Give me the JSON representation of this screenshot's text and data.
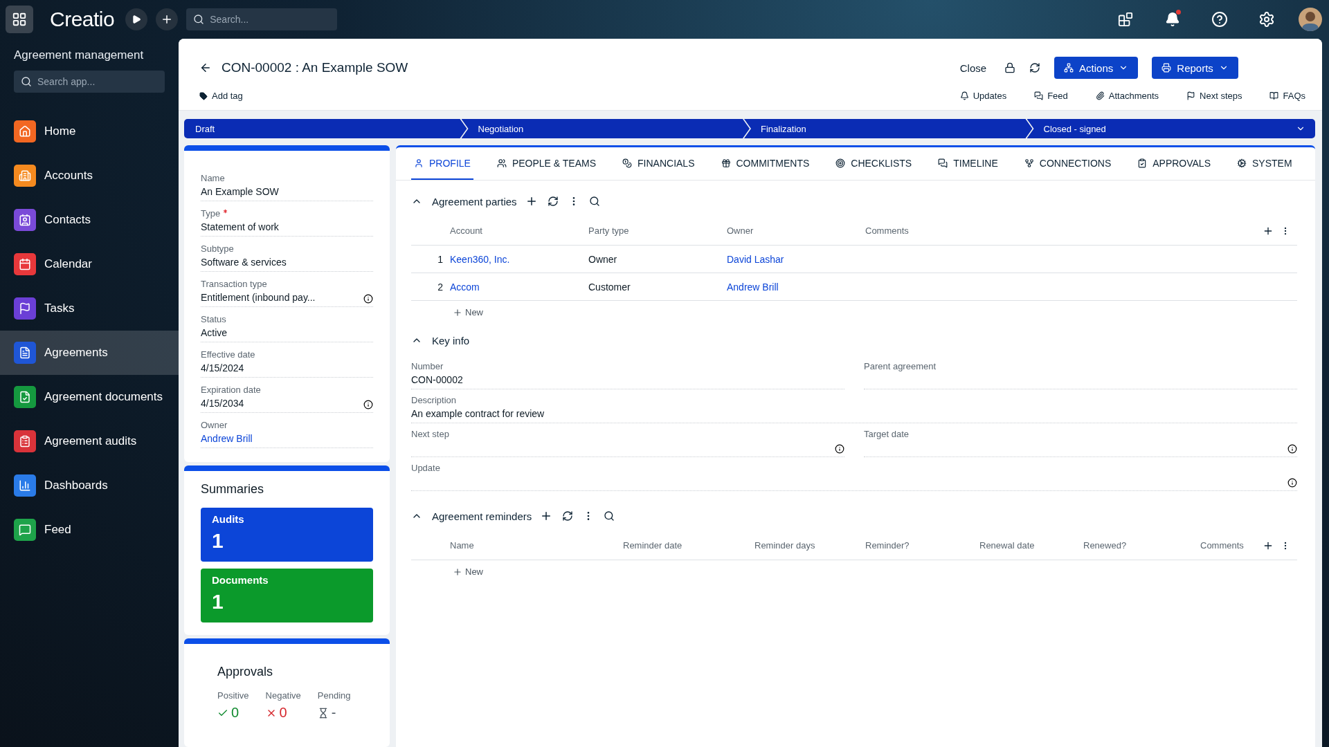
{
  "top_bar": {
    "logo": "Creatio",
    "search": {
      "placeholder": "Search..."
    },
    "has_notifications": true
  },
  "sidebar": {
    "title": "Agreement management",
    "search": {
      "placeholder": "Search app..."
    },
    "items": [
      {
        "label": "Home",
        "color": "#f26722",
        "selected": false
      },
      {
        "label": "Accounts",
        "color": "#f58a1f",
        "selected": false
      },
      {
        "label": "Contacts",
        "color": "#7a4ad8",
        "selected": false
      },
      {
        "label": "Calendar",
        "color": "#e8383b",
        "selected": false
      },
      {
        "label": "Tasks",
        "color": "#6b3fd6",
        "selected": false
      },
      {
        "label": "Agreements",
        "color": "#1f56d6",
        "selected": true
      },
      {
        "label": "Agreement documents",
        "color": "#15993f",
        "selected": false
      },
      {
        "label": "Agreement audits",
        "color": "#d9333a",
        "selected": false
      },
      {
        "label": "Dashboards",
        "color": "#2a7be8",
        "selected": false
      },
      {
        "label": "Feed",
        "color": "#1ea34a",
        "selected": false
      }
    ]
  },
  "record": {
    "title": "CON-00002 : An Example SOW",
    "add_tag": "Add tag",
    "close": "Close",
    "actions": "Actions",
    "reports": "Reports",
    "links": [
      "Updates",
      "Feed",
      "Attachments",
      "Next steps",
      "FAQs"
    ]
  },
  "stages": [
    {
      "label": "Draft"
    },
    {
      "label": "Negotiation"
    },
    {
      "label": "Finalization"
    },
    {
      "label": "Closed - signed"
    }
  ],
  "profile": [
    {
      "label": "Name",
      "value": "An Example SOW",
      "kind": "text",
      "required": false,
      "info": false
    },
    {
      "label": "Type",
      "value": "Statement of work",
      "kind": "text",
      "required": true,
      "info": false
    },
    {
      "label": "Subtype",
      "value": "Software & services",
      "kind": "text",
      "required": false,
      "info": false
    },
    {
      "label": "Transaction type",
      "value": "Entitlement (inbound pay...",
      "kind": "text",
      "required": false,
      "info": true
    },
    {
      "label": "Status",
      "value": "Active",
      "kind": "text",
      "required": false,
      "info": false
    },
    {
      "label": "Effective date",
      "value": "4/15/2024",
      "kind": "text",
      "required": false,
      "info": false
    },
    {
      "label": "Expiration date",
      "value": "4/15/2034",
      "kind": "text",
      "required": false,
      "info": true
    },
    {
      "label": "Owner",
      "value": "Andrew Brill",
      "kind": "link",
      "required": false,
      "info": false
    }
  ],
  "summaries": {
    "title": "Summaries",
    "cards": [
      {
        "label": "Audits",
        "value": "1",
        "color": "#0c45d8"
      },
      {
        "label": "Documents",
        "value": "1",
        "color": "#0b9a2b"
      }
    ]
  },
  "approvals": {
    "title": "Approvals",
    "stats": [
      {
        "label": "Positive",
        "value": "0",
        "kind": "positive"
      },
      {
        "label": "Negative",
        "value": "0",
        "kind": "negative"
      },
      {
        "label": "Pending",
        "value": "-",
        "kind": "pending"
      }
    ]
  },
  "tabs": [
    {
      "label": "PROFILE",
      "selected": true
    },
    {
      "label": "PEOPLE & TEAMS",
      "selected": false
    },
    {
      "label": "FINANCIALS",
      "selected": false
    },
    {
      "label": "COMMITMENTS",
      "selected": false
    },
    {
      "label": "CHECKLISTS",
      "selected": false
    },
    {
      "label": "TIMELINE",
      "selected": false
    },
    {
      "label": "CONNECTIONS",
      "selected": false
    },
    {
      "label": "APPROVALS",
      "selected": false
    },
    {
      "label": "SYSTEM",
      "selected": false
    }
  ],
  "parties": {
    "title": "Agreement parties",
    "columns": [
      "Account",
      "Party type",
      "Owner",
      "Comments"
    ],
    "rows": [
      {
        "index": "1",
        "account": "Keen360, Inc.",
        "party_type": "Owner",
        "owner": "David Lashar"
      },
      {
        "index": "2",
        "account": "Accom",
        "party_type": "Customer",
        "owner": "Andrew Brill"
      }
    ],
    "new_label": "New"
  },
  "key_info": {
    "title": "Key info",
    "fields": [
      {
        "label": "Number",
        "value": "CON-00002",
        "kind": "half",
        "info": false
      },
      {
        "label": "Parent agreement",
        "kind": "half",
        "info": false
      },
      {
        "label": "Description",
        "value": "An example contract for review",
        "kind": "wide",
        "info": false
      },
      {
        "label": "Next step",
        "kind": "half",
        "info": true
      },
      {
        "label": "Target date",
        "kind": "half",
        "info": true
      },
      {
        "label": "Update",
        "kind": "wide",
        "info": true
      }
    ]
  },
  "reminders": {
    "title": "Agreement reminders",
    "columns": [
      "Name",
      "Reminder date",
      "Reminder days",
      "Reminder?",
      "Renewal date",
      "Renewed?",
      "Comments"
    ],
    "new_label": "New"
  }
}
